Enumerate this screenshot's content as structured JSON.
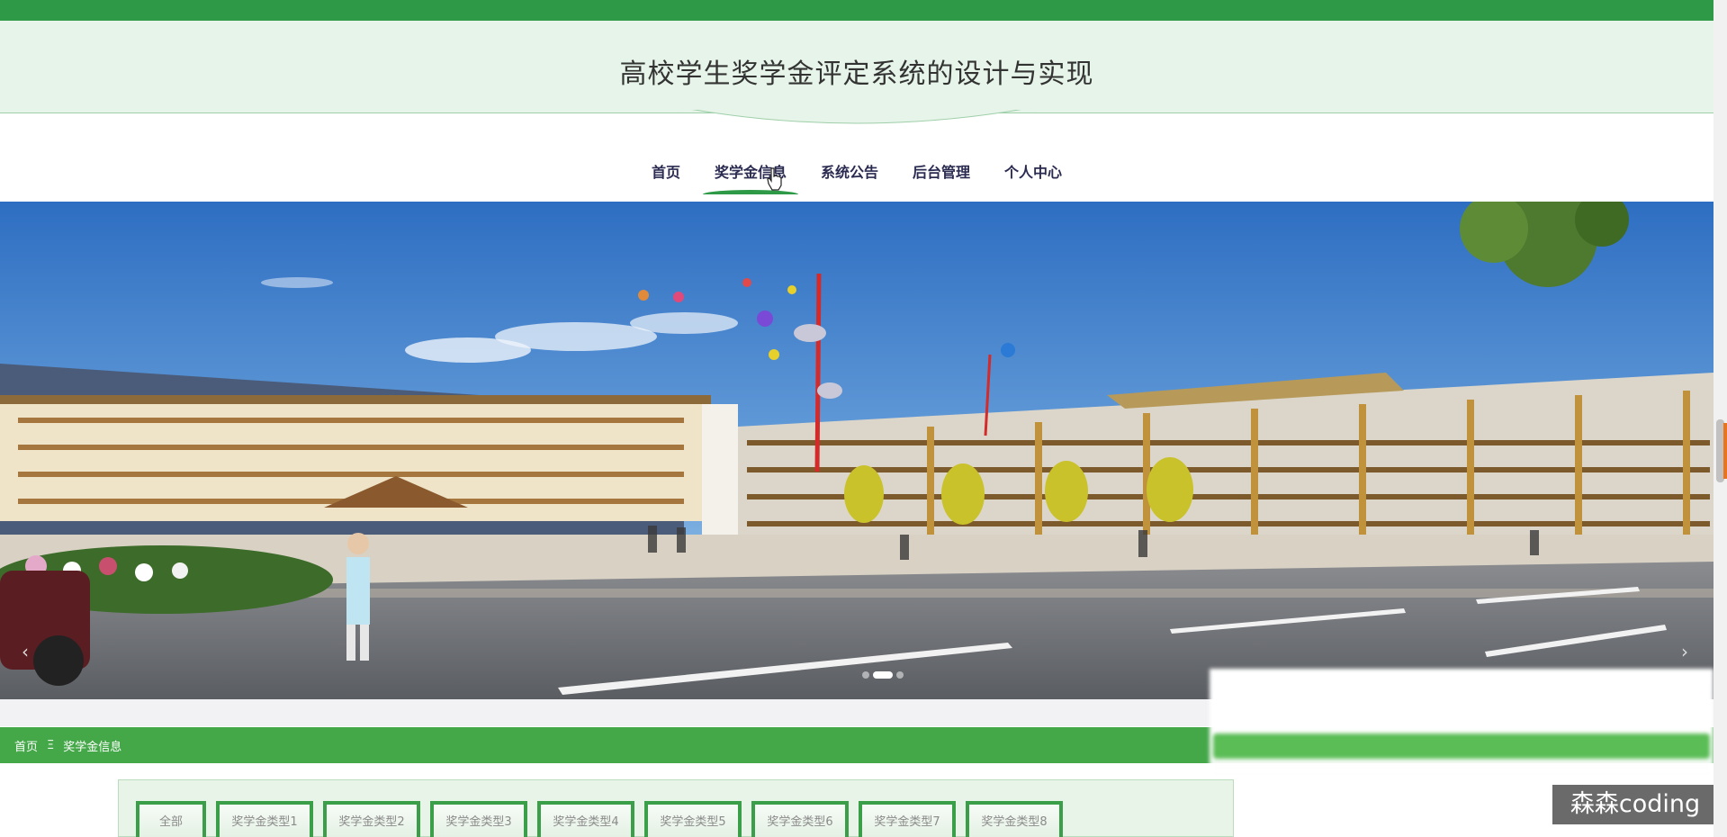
{
  "header": {
    "title": "高校学生奖学金评定系统的设计与实现"
  },
  "nav": {
    "items": [
      {
        "label": "首页"
      },
      {
        "label": "奖学金信息"
      },
      {
        "label": "系统公告"
      },
      {
        "label": "后台管理"
      },
      {
        "label": "个人中心"
      }
    ],
    "active_index": 1
  },
  "banner": {
    "prev_symbol": "‹",
    "next_symbol": "›",
    "slide_count": 3,
    "active_slide": 1
  },
  "breadcrumb": {
    "home": "首页",
    "separator": "Ξ",
    "current": "奖学金信息"
  },
  "categories": [
    "全部",
    "奖学金类型1",
    "奖学金类型2",
    "奖学金类型3",
    "奖学金类型4",
    "奖学金类型5",
    "奖学金类型6",
    "奖学金类型7",
    "奖学金类型8"
  ],
  "watermark": {
    "text": "森森coding"
  },
  "colors": {
    "brand_green": "#2e9a48",
    "breadcrumb_green": "#44a748",
    "header_bg": "#e6f4e9"
  },
  "icons": {
    "cursor": "pointer-hand-icon"
  }
}
